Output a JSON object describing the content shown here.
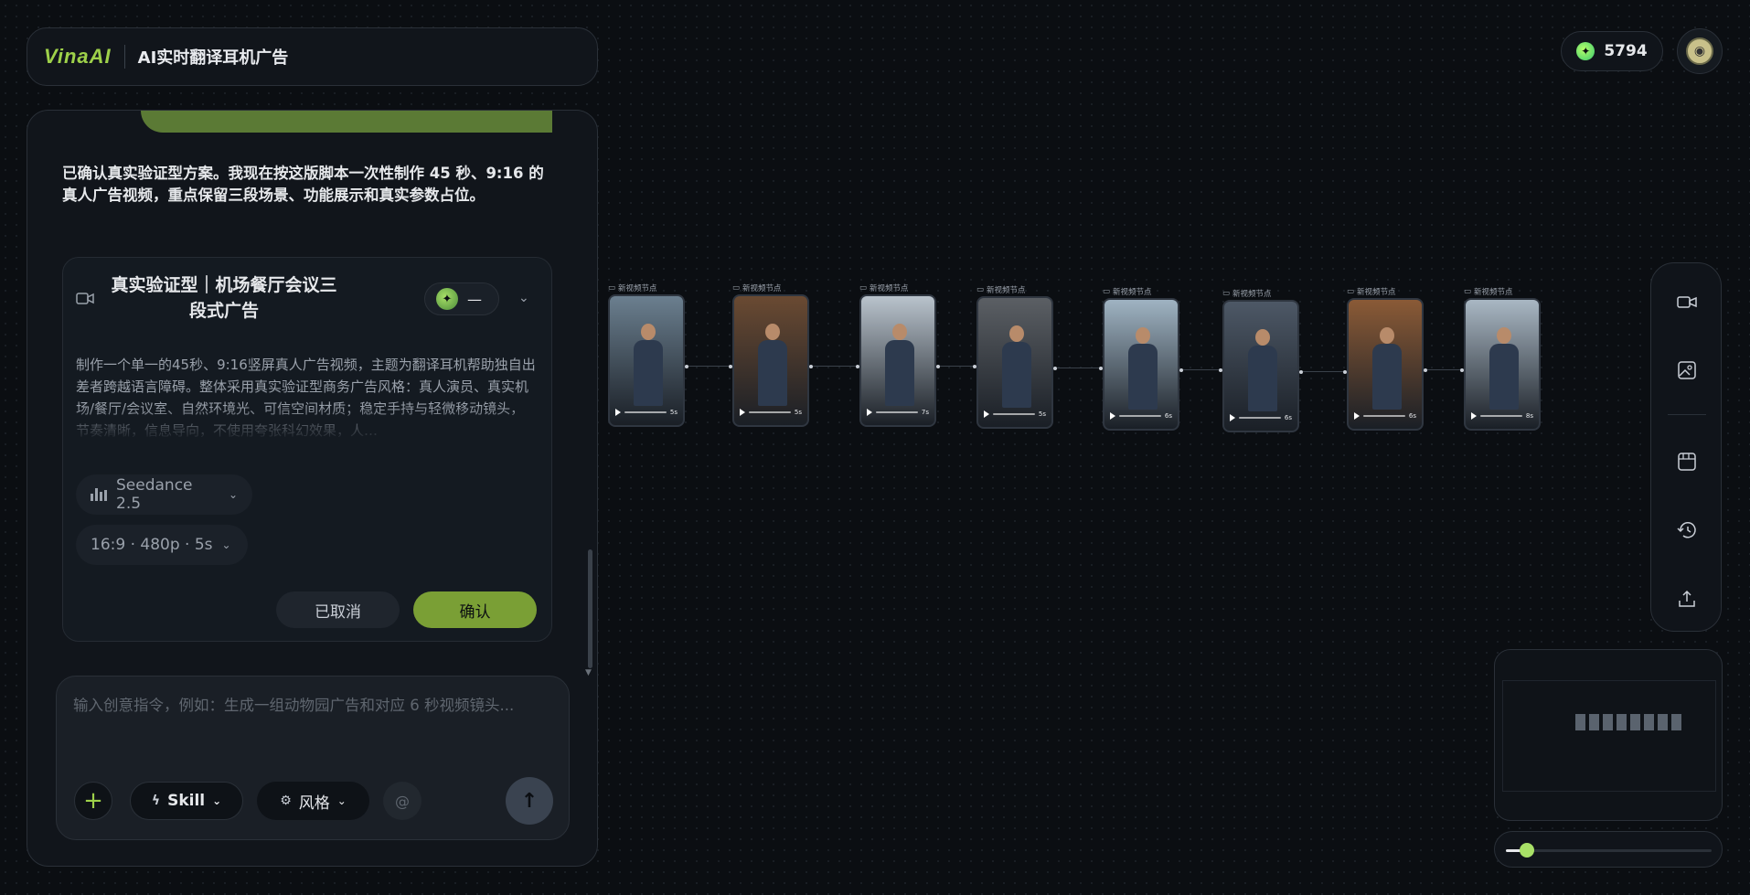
{
  "header": {
    "logo": "VinaAI",
    "project_title": "AI实时翻译耳机广告"
  },
  "account": {
    "credits": "5794",
    "credits_icon": "sparkle-icon",
    "avatar_icon": "alien-avatar-icon"
  },
  "chat": {
    "assistant_message": "已确认真实验证型方案。我现在按这版脚本一次性制作 45 秒、9:16 的真人广告视频，重点保留三段场景、功能展示和真实参数占位。",
    "plan_card": {
      "title": "真实验证型｜机场餐厅会议三段式广告",
      "model_badge_text": "—",
      "description": "制作一个单一的45秒、9:16竖屏真人广告视频，主题为翻译耳机帮助独自出差者跨越语言障碍。整体采用真实验证型商务广告风格：真人演员、真实机场/餐厅/会议室、自然环境光、可信空间材质；稳定手持与轻微移动镜头，节奏清晰，信息导向，不使用夸张科幻效果，人…",
      "model_option": "Seedance 2.5",
      "format_option": "16:9 · 480p · 5s",
      "cancel_label": "已取消",
      "confirm_label": "确认"
    }
  },
  "composer": {
    "placeholder": "输入创意指令，例如：生成一组动物园广告和对应 6 秒视频镜头...",
    "skill_label": "Skill",
    "style_label": "风格"
  },
  "canvas": {
    "nodes": [
      {
        "label": "新视频节点",
        "duration": "5s",
        "bg": "#6b7f8f"
      },
      {
        "label": "新视频节点",
        "duration": "5s",
        "bg": "#6a4a32"
      },
      {
        "label": "新视频节点",
        "duration": "7s",
        "bg": "#b9c3cc"
      },
      {
        "label": "新视频节点",
        "duration": "5s",
        "bg": "#5b5f64"
      },
      {
        "label": "新视频节点",
        "duration": "6s",
        "bg": "#9fb3c2"
      },
      {
        "label": "新视频节点",
        "duration": "6s",
        "bg": "#4d5866"
      },
      {
        "label": "新视频节点",
        "duration": "6s",
        "bg": "#8a5a36"
      },
      {
        "label": "新视频节点",
        "duration": "8s",
        "bg": "#a9b7c3"
      }
    ]
  },
  "right_toolbar": {
    "items": [
      "video-camera-icon",
      "image-icon",
      "storyboard-icon",
      "history-icon",
      "export-icon"
    ]
  },
  "zoom": {
    "level": 0.1
  },
  "colors": {
    "accent": "#9ed14a",
    "confirm": "#7a9f35",
    "background": "#0b0e12"
  }
}
